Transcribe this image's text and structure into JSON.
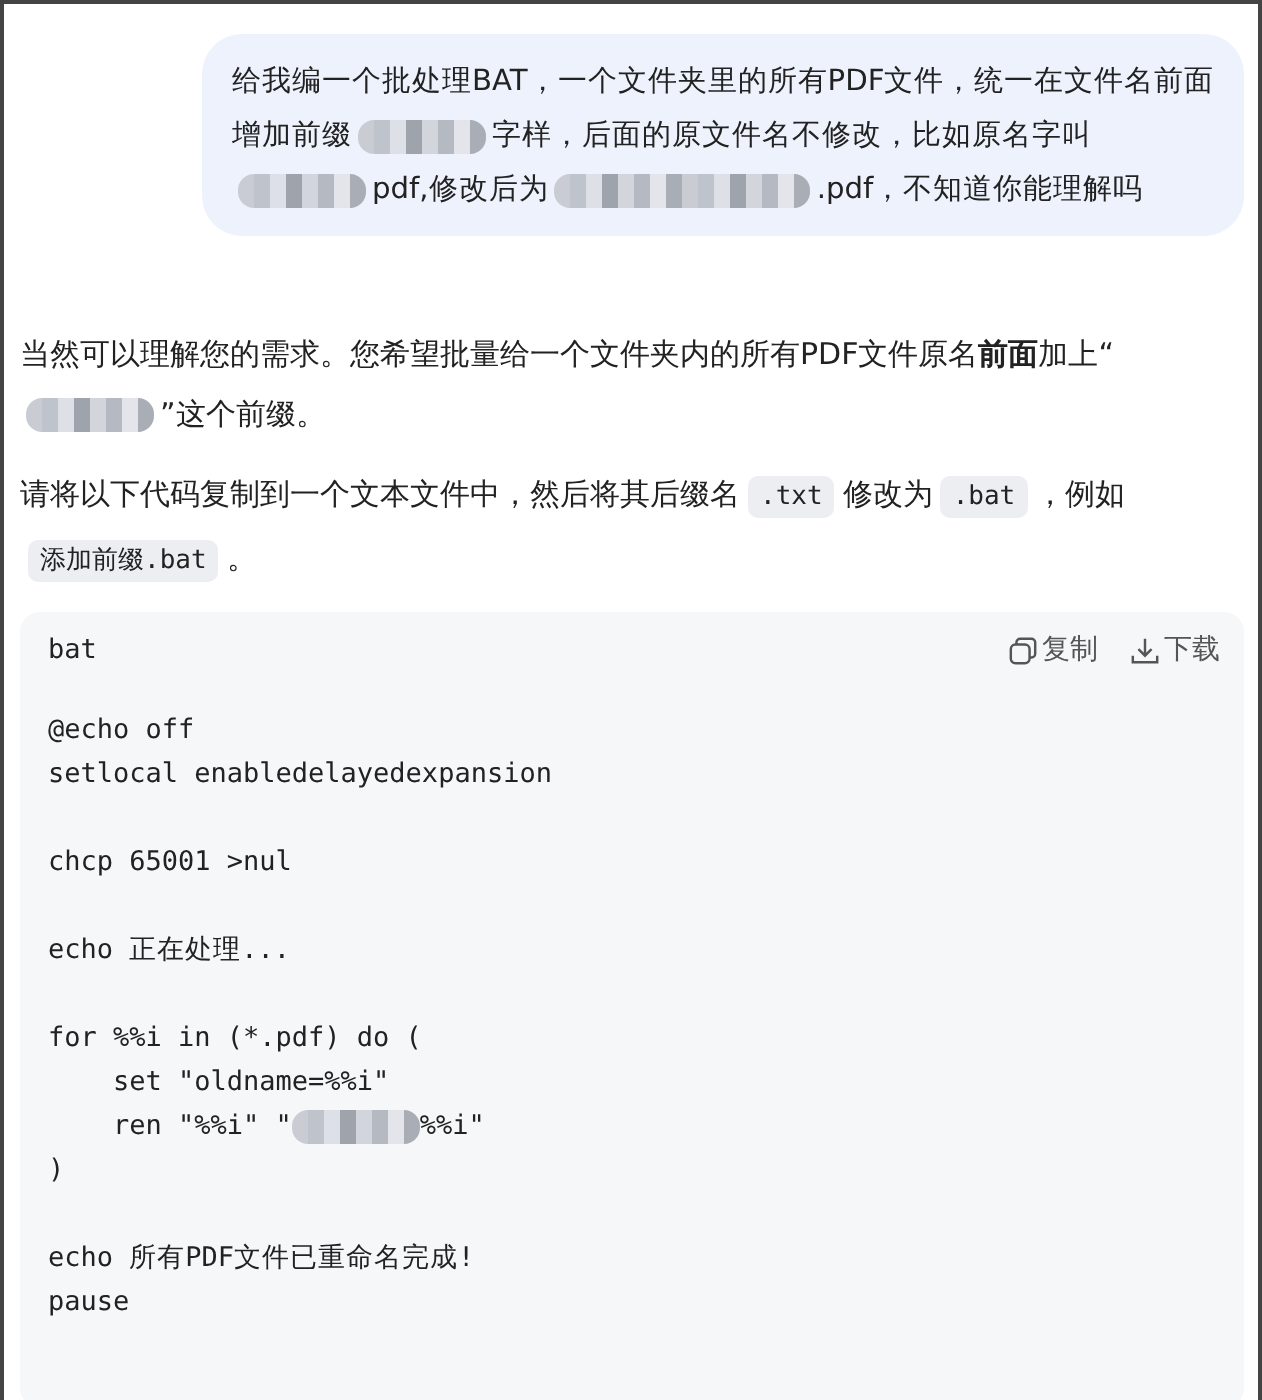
{
  "user_message": [
    {
      "kind": "text",
      "text": "给我编一个批处理BAT，一个文件夹里的所有PDF文件，统一在文件名前面增加前缀"
    },
    {
      "kind": "blur"
    },
    {
      "kind": "text",
      "text": "字样，后面的原文件名不修改，比如原名字叫"
    },
    {
      "kind": "blur"
    },
    {
      "kind": "text",
      "text": "pdf,修改后为"
    },
    {
      "kind": "long-blur"
    },
    {
      "kind": "text",
      "text": ".pdf，不知道你能理解吗"
    }
  ],
  "reply_paragraphs": [
    [
      {
        "kind": "text",
        "text": "当然可以理解您的需求。您希望批量给一个文件夹内的所有PDF文件原名"
      },
      {
        "kind": "bold",
        "text": "前面"
      },
      {
        "kind": "text",
        "text": "加上“"
      },
      {
        "kind": "blur"
      },
      {
        "kind": "text",
        "text": "”这个前缀。"
      }
    ],
    [
      {
        "kind": "text",
        "text": "请将以下代码复制到一个文本文件中，然后将其后缀名"
      },
      {
        "kind": "code",
        "text": ".txt"
      },
      {
        "kind": "text",
        "text": "修改为"
      },
      {
        "kind": "code",
        "text": ".bat"
      },
      {
        "kind": "text",
        "text": "，例如"
      },
      {
        "kind": "code",
        "text": "添加前缀.bat"
      },
      {
        "kind": "text",
        "text": "。"
      }
    ]
  ],
  "code_block": {
    "language": "bat",
    "copy_label": "复制",
    "download_label": "下载",
    "groups": [
      [
        [
          {
            "kind": "text",
            "text": "@echo off"
          }
        ],
        [
          {
            "kind": "text",
            "text": "setlocal enabledelayedexpansion"
          }
        ]
      ],
      [
        [
          {
            "kind": "text",
            "text": "chcp 65001 >nul"
          }
        ]
      ],
      [
        [
          {
            "kind": "text",
            "text": "echo 正在处理..."
          }
        ]
      ],
      [
        [
          {
            "kind": "text",
            "text": "for %%i in (*.pdf) do ("
          }
        ],
        [
          {
            "kind": "text",
            "text": "    set \"oldname=%%i\""
          }
        ],
        [
          {
            "kind": "text",
            "text": "    ren \"%%i\" \""
          },
          {
            "kind": "blur"
          },
          {
            "kind": "text",
            "text": "%%i\""
          }
        ],
        [
          {
            "kind": "text",
            "text": ")"
          }
        ]
      ],
      [
        [
          {
            "kind": "text",
            "text": "echo 所有PDF文件已重命名完成!"
          }
        ],
        [
          {
            "kind": "text",
            "text": "pause"
          }
        ]
      ]
    ]
  }
}
